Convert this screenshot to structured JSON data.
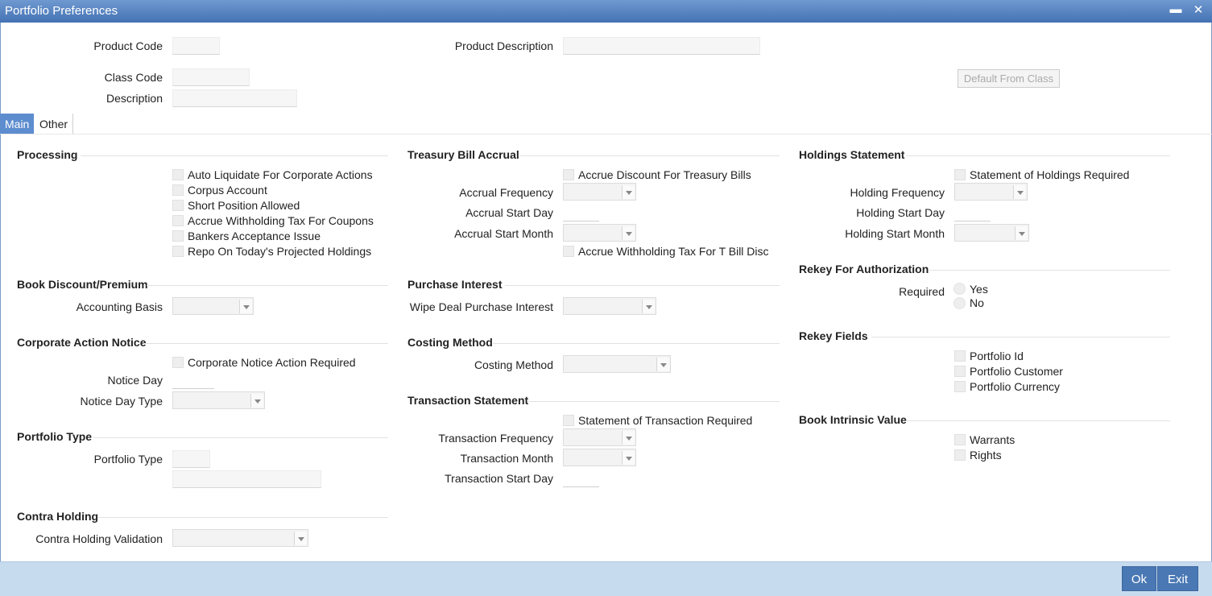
{
  "window": {
    "title": "Portfolio Preferences",
    "minimize": "▬",
    "close": "✕"
  },
  "header": {
    "product_code": "Product Code",
    "product_description": "Product Description",
    "class_code": "Class Code",
    "description": "Description",
    "default_from_class": "Default From Class"
  },
  "tabs": {
    "main": "Main",
    "other": "Other"
  },
  "processing": {
    "title": "Processing",
    "items": [
      "Auto Liquidate For Corporate Actions",
      "Corpus Account",
      "Short Position Allowed",
      "Accrue Withholding Tax For Coupons",
      "Bankers Acceptance Issue",
      "Repo On Today's Projected Holdings"
    ]
  },
  "book_discount": {
    "title": "Book Discount/Premium",
    "accounting_basis": "Accounting Basis"
  },
  "corporate_action": {
    "title": "Corporate Action Notice",
    "notice_required": "Corporate Notice Action Required",
    "notice_day": "Notice Day",
    "notice_day_type": "Notice Day Type"
  },
  "portfolio_type": {
    "title": "Portfolio Type",
    "label": "Portfolio Type"
  },
  "contra_holding": {
    "title": "Contra Holding",
    "validation": "Contra Holding Validation"
  },
  "treasury": {
    "title": "Treasury Bill Accrual",
    "accrue_discount": "Accrue Discount For Treasury Bills",
    "accrual_frequency": "Accrual Frequency",
    "accrual_start_day": "Accrual Start Day",
    "accrual_start_month": "Accrual Start Month",
    "withholding_tbill": "Accrue Withholding Tax For T Bill Disc"
  },
  "purchase_interest": {
    "title": "Purchase Interest",
    "wipe": "Wipe Deal Purchase Interest"
  },
  "costing": {
    "title": "Costing Method",
    "label": "Costing Method"
  },
  "transaction_statement": {
    "title": "Transaction Statement",
    "required": "Statement of Transaction Required",
    "frequency": "Transaction Frequency",
    "month": "Transaction Month",
    "start_day": "Transaction Start Day"
  },
  "holdings": {
    "title": "Holdings Statement",
    "required": "Statement of Holdings Required",
    "frequency": "Holding Frequency",
    "start_day": "Holding Start Day",
    "start_month": "Holding Start Month"
  },
  "rekey_auth": {
    "title": "Rekey For Authorization",
    "required": "Required",
    "yes": "Yes",
    "no": "No"
  },
  "rekey_fields": {
    "title": "Rekey Fields",
    "items": [
      "Portfolio Id",
      "Portfolio Customer",
      "Portfolio Currency"
    ]
  },
  "intrinsic": {
    "title": "Book Intrinsic Value",
    "items": [
      "Warrants",
      "Rights"
    ]
  },
  "footer": {
    "ok": "Ok",
    "exit": "Exit"
  }
}
